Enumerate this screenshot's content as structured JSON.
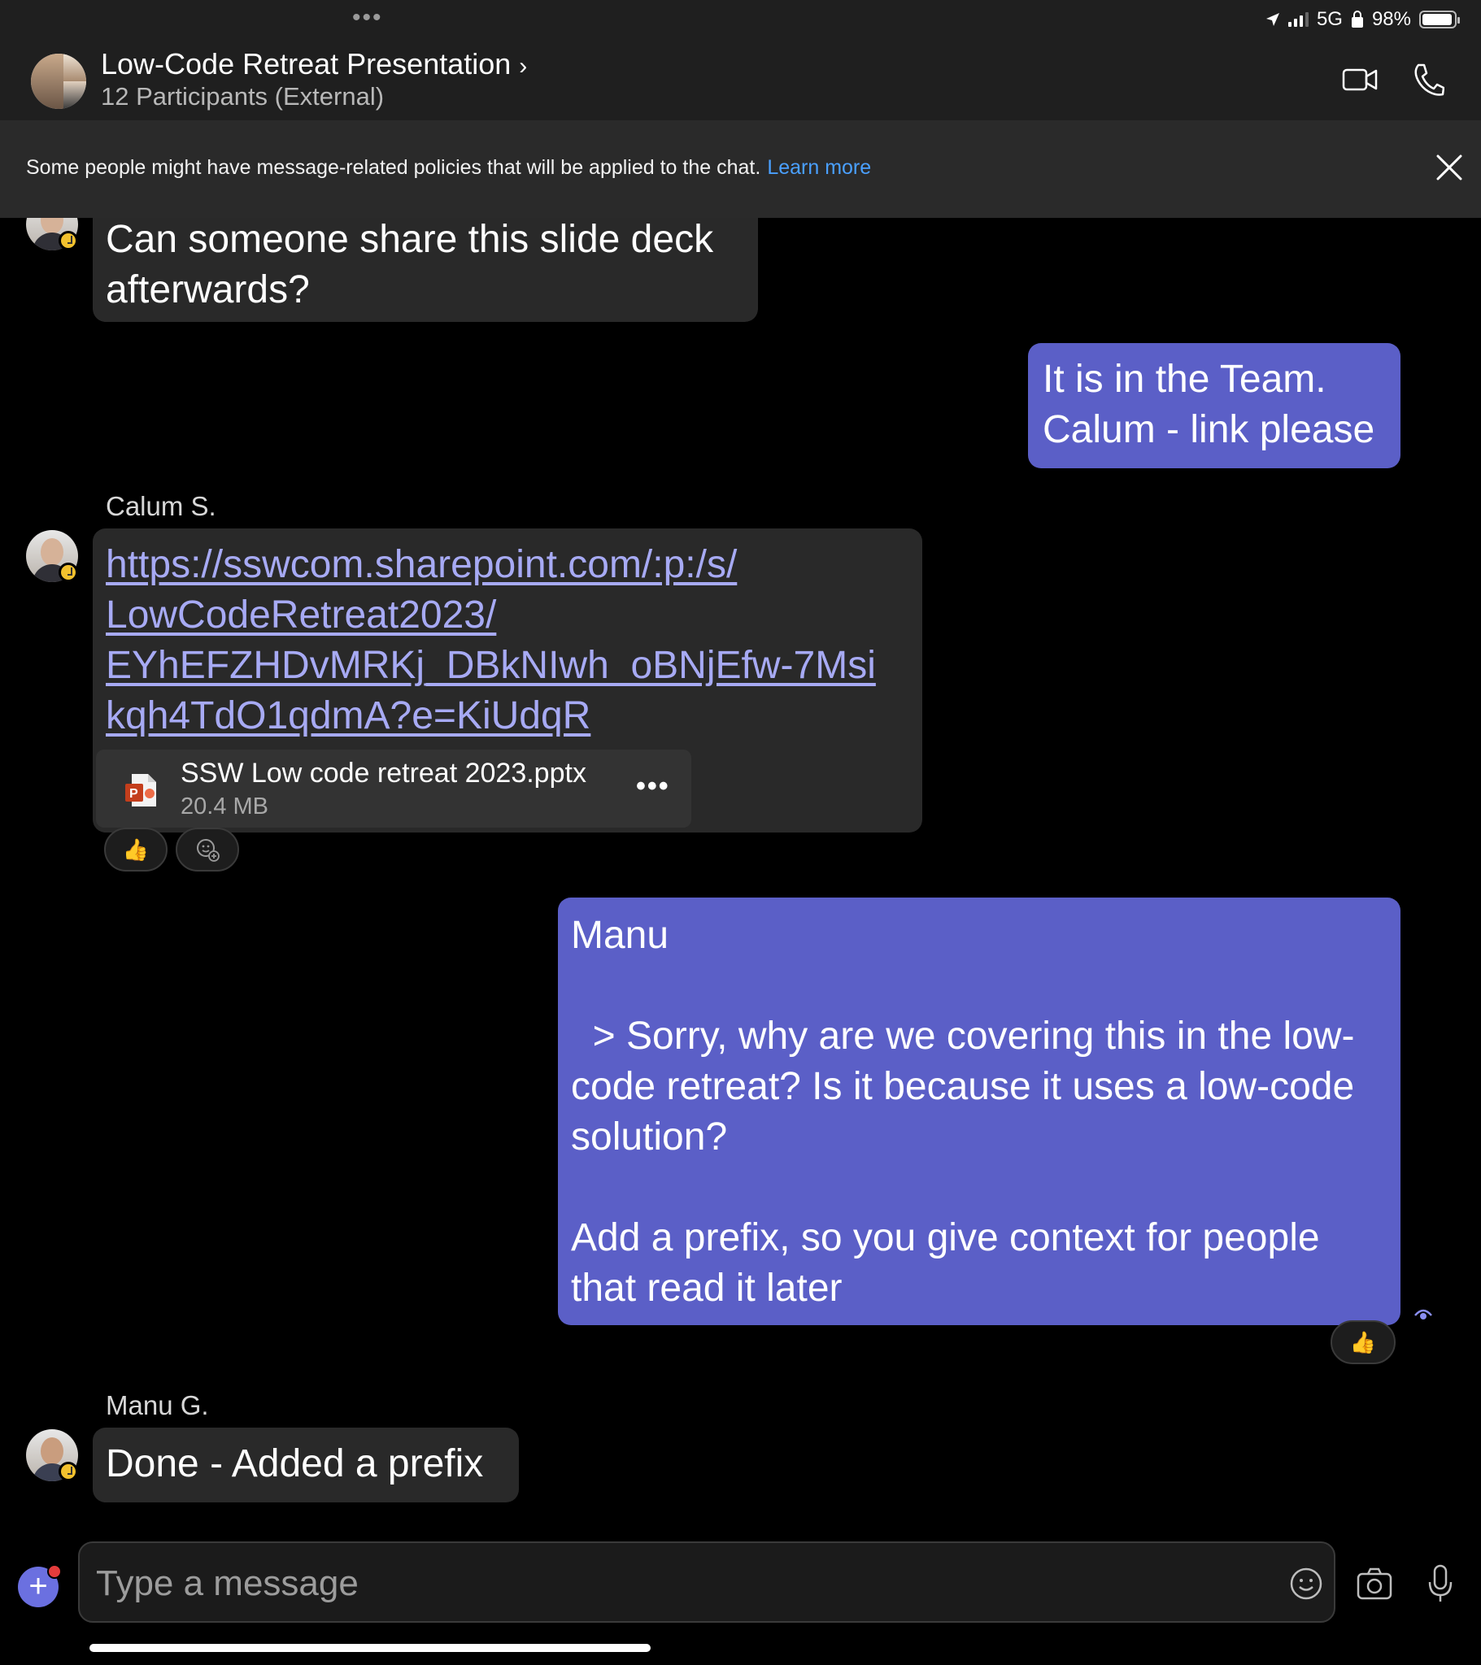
{
  "status_bar": {
    "network": "5G",
    "battery": "98%"
  },
  "header": {
    "title": "Low-Code Retreat Presentation",
    "title_chevron": "›",
    "subtitle": "12 Participants (External)"
  },
  "banner": {
    "text": "Some people might have message-related policies that will be applied to the chat.",
    "link": "Learn more"
  },
  "messages": [
    {
      "direction": "incoming",
      "text": "Can someone share this slide deck\nafterwards?"
    },
    {
      "direction": "outgoing",
      "text": "It is in the Team.\nCalum - link please"
    },
    {
      "direction": "incoming",
      "sender": "Calum S.",
      "link": "https://sswcom.sharepoint.com/:p:/s/LowCodeRetreat2023/EYhEFZHDvMRKj_DBkNIwh_oBNjEfw-7MsikqH4TdO1qdmA?e=KiUdqR",
      "link_lines": [
        "https://sswcom.sharepoint.com/:p:/s/",
        "LowCodeRetreat2023/",
        "EYhEFZHDvMRKj_DBkNIwh_oBNjEfw-7Msi",
        "kqh4TdO1qdmA?e=KiUdqR"
      ],
      "attachment": {
        "name": "SSW Low code retreat 2023.pptx",
        "size": "20.4 MB",
        "more": "•••"
      },
      "reactions": [
        "👍"
      ]
    },
    {
      "direction": "outgoing",
      "text": "Manu\n\n  > Sorry, why are we covering this in the low-\ncode retreat? Is it because it uses a low-code\nsolution?\n\nAdd a prefix, so you give context for people\nthat read it later",
      "reactions": [
        "👍"
      ]
    },
    {
      "direction": "incoming",
      "sender": "Manu G.",
      "text": "Done - Added a prefix"
    }
  ],
  "composer": {
    "placeholder": "Type a message",
    "add_label": "+"
  },
  "colors": {
    "outgoing_bubble": "#5b5fc7",
    "incoming_bubble": "#292929",
    "link": "#a7aaf4",
    "banner_link": "#4aa0ff",
    "presence_away": "#f2c12e"
  }
}
